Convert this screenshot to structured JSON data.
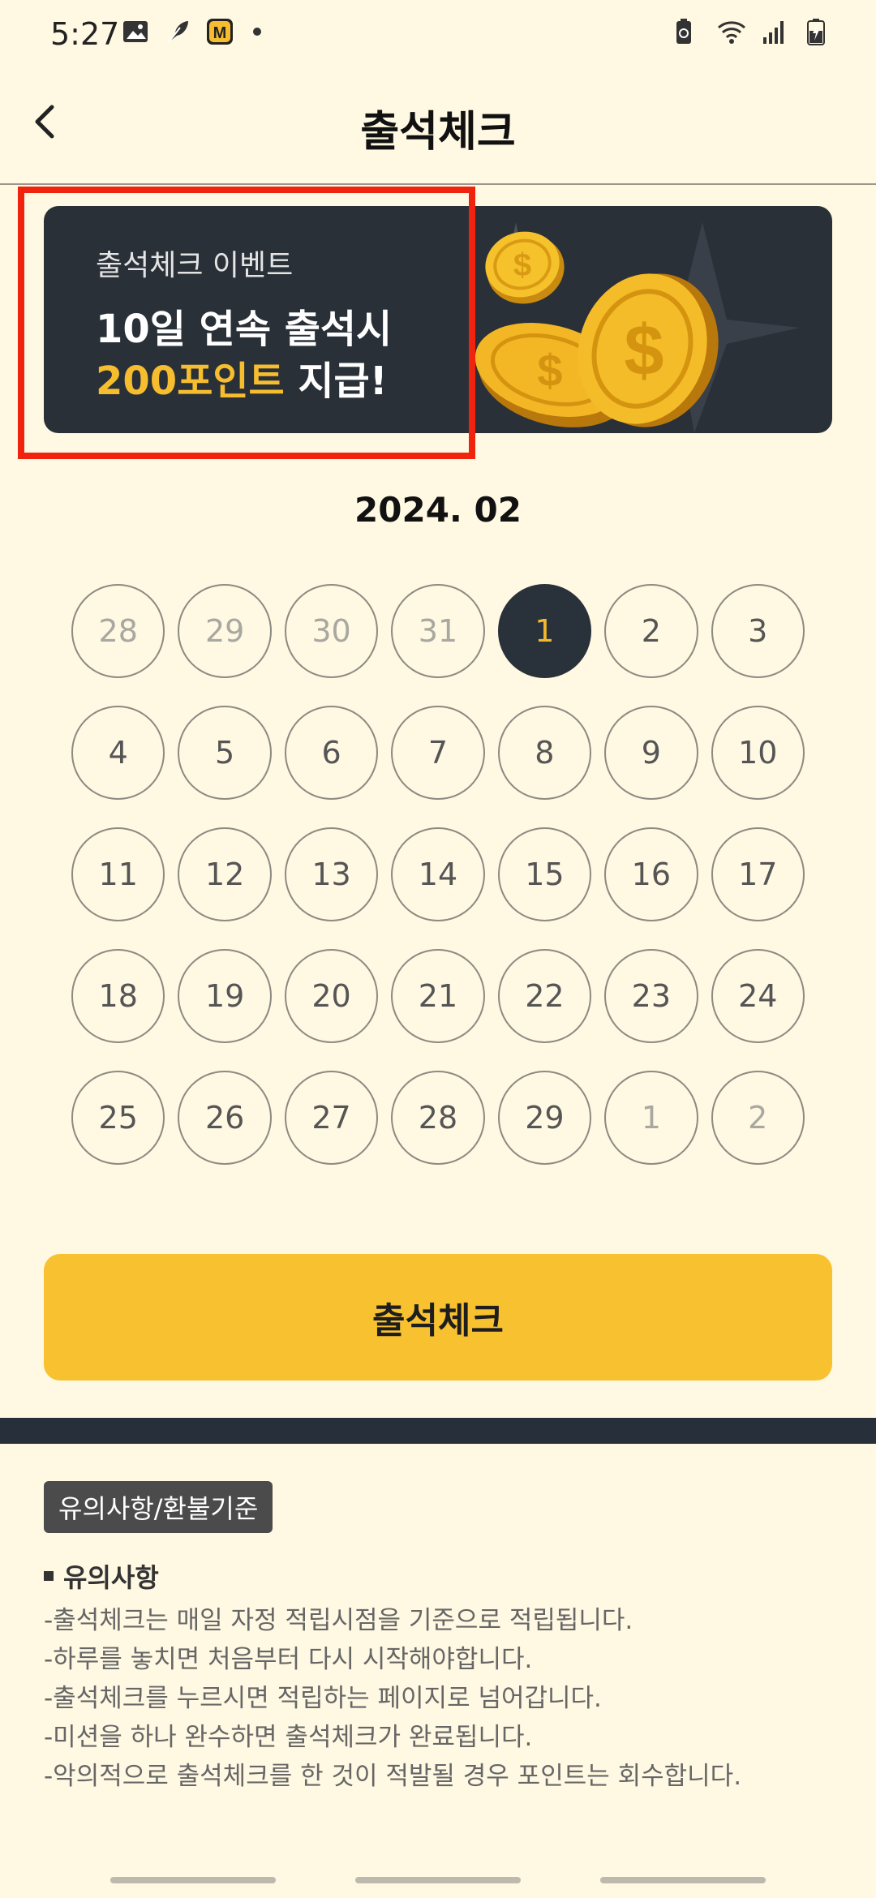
{
  "status_bar": {
    "time": "5:27",
    "left_icons": [
      "image-icon",
      "feather-app-icon",
      "m-app-icon",
      "notification-dot-icon"
    ],
    "right_icons": [
      "battery-saver-icon",
      "wifi-icon",
      "signal-icon",
      "battery-charging-icon"
    ]
  },
  "header": {
    "title": "출석체크",
    "back_icon": "chevron-left-icon"
  },
  "banner": {
    "subtitle": "출석체크 이벤트",
    "line1": "10일 연속 출석시",
    "highlight": "200포인트",
    "line2_rest": " 지급!",
    "art_icon": "gold-coins-icon",
    "colors": {
      "background": "#2a3038",
      "highlight": "#f6bd2f"
    }
  },
  "calendar": {
    "month": "2024. 02",
    "weeks": [
      [
        {
          "d": "28",
          "muted": true
        },
        {
          "d": "29",
          "muted": true
        },
        {
          "d": "30",
          "muted": true
        },
        {
          "d": "31",
          "muted": true
        },
        {
          "d": "1",
          "today": true
        },
        {
          "d": "2"
        },
        {
          "d": "3"
        }
      ],
      [
        {
          "d": "4"
        },
        {
          "d": "5"
        },
        {
          "d": "6"
        },
        {
          "d": "7"
        },
        {
          "d": "8"
        },
        {
          "d": "9"
        },
        {
          "d": "10"
        }
      ],
      [
        {
          "d": "11"
        },
        {
          "d": "12"
        },
        {
          "d": "13"
        },
        {
          "d": "14"
        },
        {
          "d": "15"
        },
        {
          "d": "16"
        },
        {
          "d": "17"
        }
      ],
      [
        {
          "d": "18"
        },
        {
          "d": "19"
        },
        {
          "d": "20"
        },
        {
          "d": "21"
        },
        {
          "d": "22"
        },
        {
          "d": "23"
        },
        {
          "d": "24"
        }
      ],
      [
        {
          "d": "25"
        },
        {
          "d": "26"
        },
        {
          "d": "27"
        },
        {
          "d": "28"
        },
        {
          "d": "29"
        },
        {
          "d": "1",
          "muted": true
        },
        {
          "d": "2",
          "muted": true
        }
      ]
    ],
    "colors": {
      "today_bg": "#29313a",
      "today_text": "#f3b92b"
    }
  },
  "check_button": {
    "label": "출석체크",
    "color": "#f8c12f"
  },
  "notes": {
    "tag": "유의사항/환불기준",
    "heading": "유의사항",
    "lines": [
      "-출석체크는 매일 자정 적립시점을 기준으로 적립됩니다.",
      "-하루를 놓치면 처음부터 다시 시작해야합니다.",
      "-출석체크를 누르시면 적립하는 페이지로 넘어갑니다.",
      "-미션을 하나 완수하면 출석체크가 완료됩니다.",
      "-악의적으로 출석체크를 한 것이 적발될 경우 포인트는 회수합니다."
    ]
  }
}
